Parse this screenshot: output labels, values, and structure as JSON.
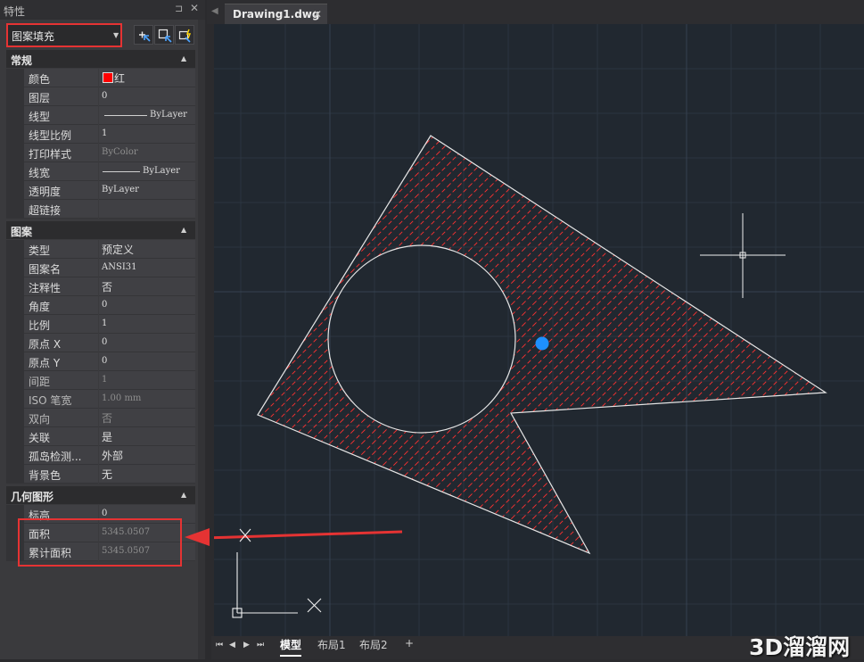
{
  "palette": {
    "title": "特性",
    "pin_icon": "pin-icon",
    "close_icon": "close-icon",
    "object_type": "图案填充",
    "toolbar": [
      {
        "name": "toggle-pickadd-button",
        "icon": "pickadd-icon"
      },
      {
        "name": "select-objects-button",
        "icon": "select-objects-icon"
      },
      {
        "name": "quick-select-button",
        "icon": "quick-select-icon"
      }
    ],
    "sections": {
      "general": "常规",
      "pattern": "图案",
      "geometry": "几何图形"
    },
    "general_rows": [
      {
        "key": "颜色",
        "value": "红",
        "swatch": "#ff0000"
      },
      {
        "key": "图层",
        "value": "0"
      },
      {
        "key": "线型",
        "value": "ByLayer",
        "line": true
      },
      {
        "key": "线型比例",
        "value": "1"
      },
      {
        "key": "打印样式",
        "value": "ByColor",
        "dim": true
      },
      {
        "key": "线宽",
        "value": "ByLayer",
        "line": true
      },
      {
        "key": "透明度",
        "value": "ByLayer"
      },
      {
        "key": "超链接",
        "value": ""
      }
    ],
    "pattern_rows": [
      {
        "key": "类型",
        "value": "预定义"
      },
      {
        "key": "图案名",
        "value": "ANSI31"
      },
      {
        "key": "注释性",
        "value": "否"
      },
      {
        "key": "角度",
        "value": "0"
      },
      {
        "key": "比例",
        "value": "1"
      },
      {
        "key": "原点 X",
        "value": "0"
      },
      {
        "key": "原点 Y",
        "value": "0"
      },
      {
        "key": "间距",
        "value": "1",
        "dim": true
      },
      {
        "key": "ISO 笔宽",
        "value": "1.00 mm",
        "dim": true
      },
      {
        "key": "双向",
        "value": "否",
        "dim": true
      },
      {
        "key": "关联",
        "value": "是"
      },
      {
        "key": "孤岛检测...",
        "value": "外部"
      },
      {
        "key": "背景色",
        "value": "无"
      }
    ],
    "geometry_rows": [
      {
        "key": "标高",
        "value": "0"
      },
      {
        "key": "面积",
        "value": "5345.0507",
        "dim": true
      },
      {
        "key": "累计面积",
        "value": "5345.0507",
        "dim": true
      }
    ]
  },
  "document": {
    "tab_label": "Drawing1.dwg",
    "close_icon": "close-icon"
  },
  "layouts": {
    "tabs": [
      "模型",
      "布局1",
      "布局2",
      "+"
    ],
    "active": "模型"
  },
  "colors": {
    "highlight_red": "#e53333",
    "hatch_red": "#ff3030",
    "grip_blue": "#1e90ff",
    "canvas_bg": "#212830"
  },
  "watermark": "3D溜溜网"
}
